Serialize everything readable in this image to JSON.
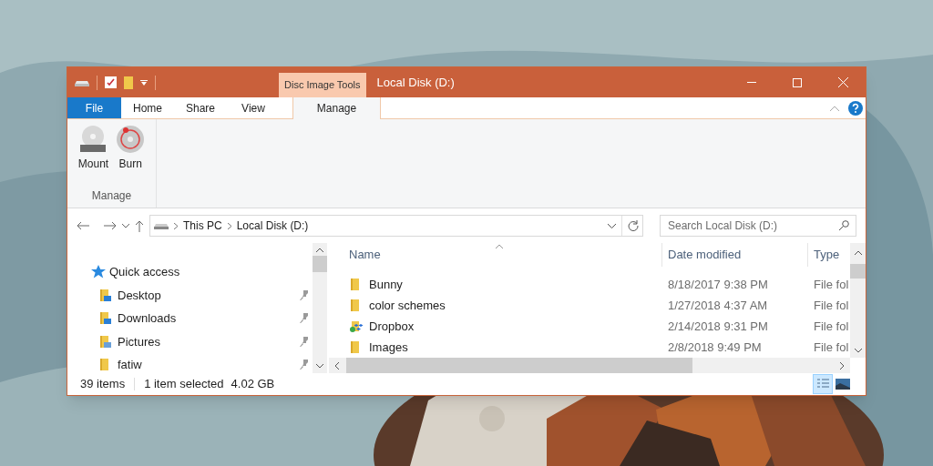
{
  "window": {
    "context_tab": "Disc Image Tools",
    "title": "Local Disk (D:)"
  },
  "tabs": [
    {
      "label": "File",
      "kind": "file",
      "selected": false
    },
    {
      "label": "Home",
      "kind": "plain",
      "selected": false
    },
    {
      "label": "Share",
      "kind": "plain",
      "selected": false
    },
    {
      "label": "View",
      "kind": "plain",
      "selected": false
    },
    {
      "label": "Manage",
      "kind": "context",
      "selected": true
    }
  ],
  "ribbon": {
    "buttons": [
      {
        "label": "Mount",
        "kind": "mount"
      },
      {
        "label": "Burn",
        "kind": "burn"
      }
    ],
    "group": "Manage"
  },
  "address": {
    "crumbs": [
      "This PC",
      "Local Disk (D:)"
    ],
    "search_placeholder": "Search Local Disk (D:)"
  },
  "nav": {
    "header": "Quick access",
    "items": [
      {
        "label": "Desktop",
        "kind": "desktop",
        "pinned": true
      },
      {
        "label": "Downloads",
        "kind": "downloads",
        "pinned": true
      },
      {
        "label": "Pictures",
        "kind": "pictures",
        "pinned": true
      },
      {
        "label": "fatiw",
        "kind": "folder",
        "pinned": true
      }
    ]
  },
  "table": {
    "columns": [
      "Name",
      "Date modified",
      "Type"
    ],
    "rows": [
      {
        "name": "Bunny",
        "kind": "folder",
        "date": "8/18/2017 9:38 PM",
        "type": "File fol"
      },
      {
        "name": "color schemes",
        "kind": "folder",
        "date": "1/27/2018 4:37 AM",
        "type": "File fol"
      },
      {
        "name": "Dropbox",
        "kind": "dropbox",
        "date": "2/14/2018 9:31 PM",
        "type": "File fol"
      },
      {
        "name": "Images",
        "kind": "folder",
        "date": "2/8/2018 9:49 PM",
        "type": "File fol"
      }
    ]
  },
  "status_bar": {
    "count": "39 items",
    "selection": "1 item selected",
    "size": "4.02 GB"
  },
  "views": [
    {
      "kind": "details",
      "selected": true
    },
    {
      "kind": "large_icons",
      "selected": false
    }
  ]
}
